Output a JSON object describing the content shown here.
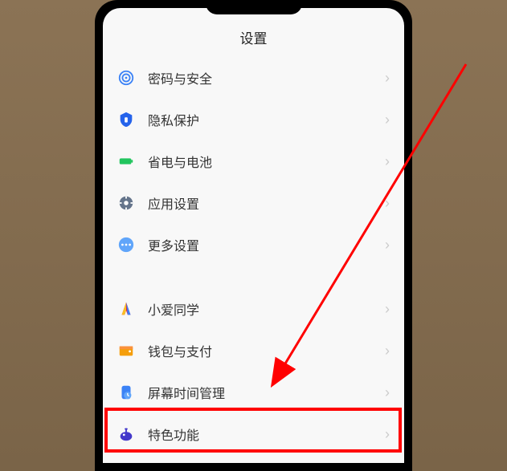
{
  "header": {
    "title": "设置"
  },
  "groups": [
    {
      "items": [
        {
          "icon": "fingerprint",
          "color": "#3b82f6",
          "label": "密码与安全"
        },
        {
          "icon": "shield",
          "color": "#2563eb",
          "label": "隐私保护"
        },
        {
          "icon": "battery",
          "color": "#22c55e",
          "label": "省电与电池"
        },
        {
          "icon": "gear",
          "color": "#64748b",
          "label": "应用设置"
        },
        {
          "icon": "dots",
          "color": "#60a5fa",
          "label": "更多设置"
        }
      ]
    },
    {
      "items": [
        {
          "icon": "xiaoai",
          "color": "#e11d48",
          "label": "小爱同学"
        },
        {
          "icon": "wallet",
          "color": "#f59e0b",
          "label": "钱包与支付"
        },
        {
          "icon": "screentime",
          "color": "#3b82f6",
          "label": "屏幕时间管理"
        },
        {
          "icon": "feature",
          "color": "#4338ca",
          "label": "特色功能"
        }
      ]
    }
  ]
}
